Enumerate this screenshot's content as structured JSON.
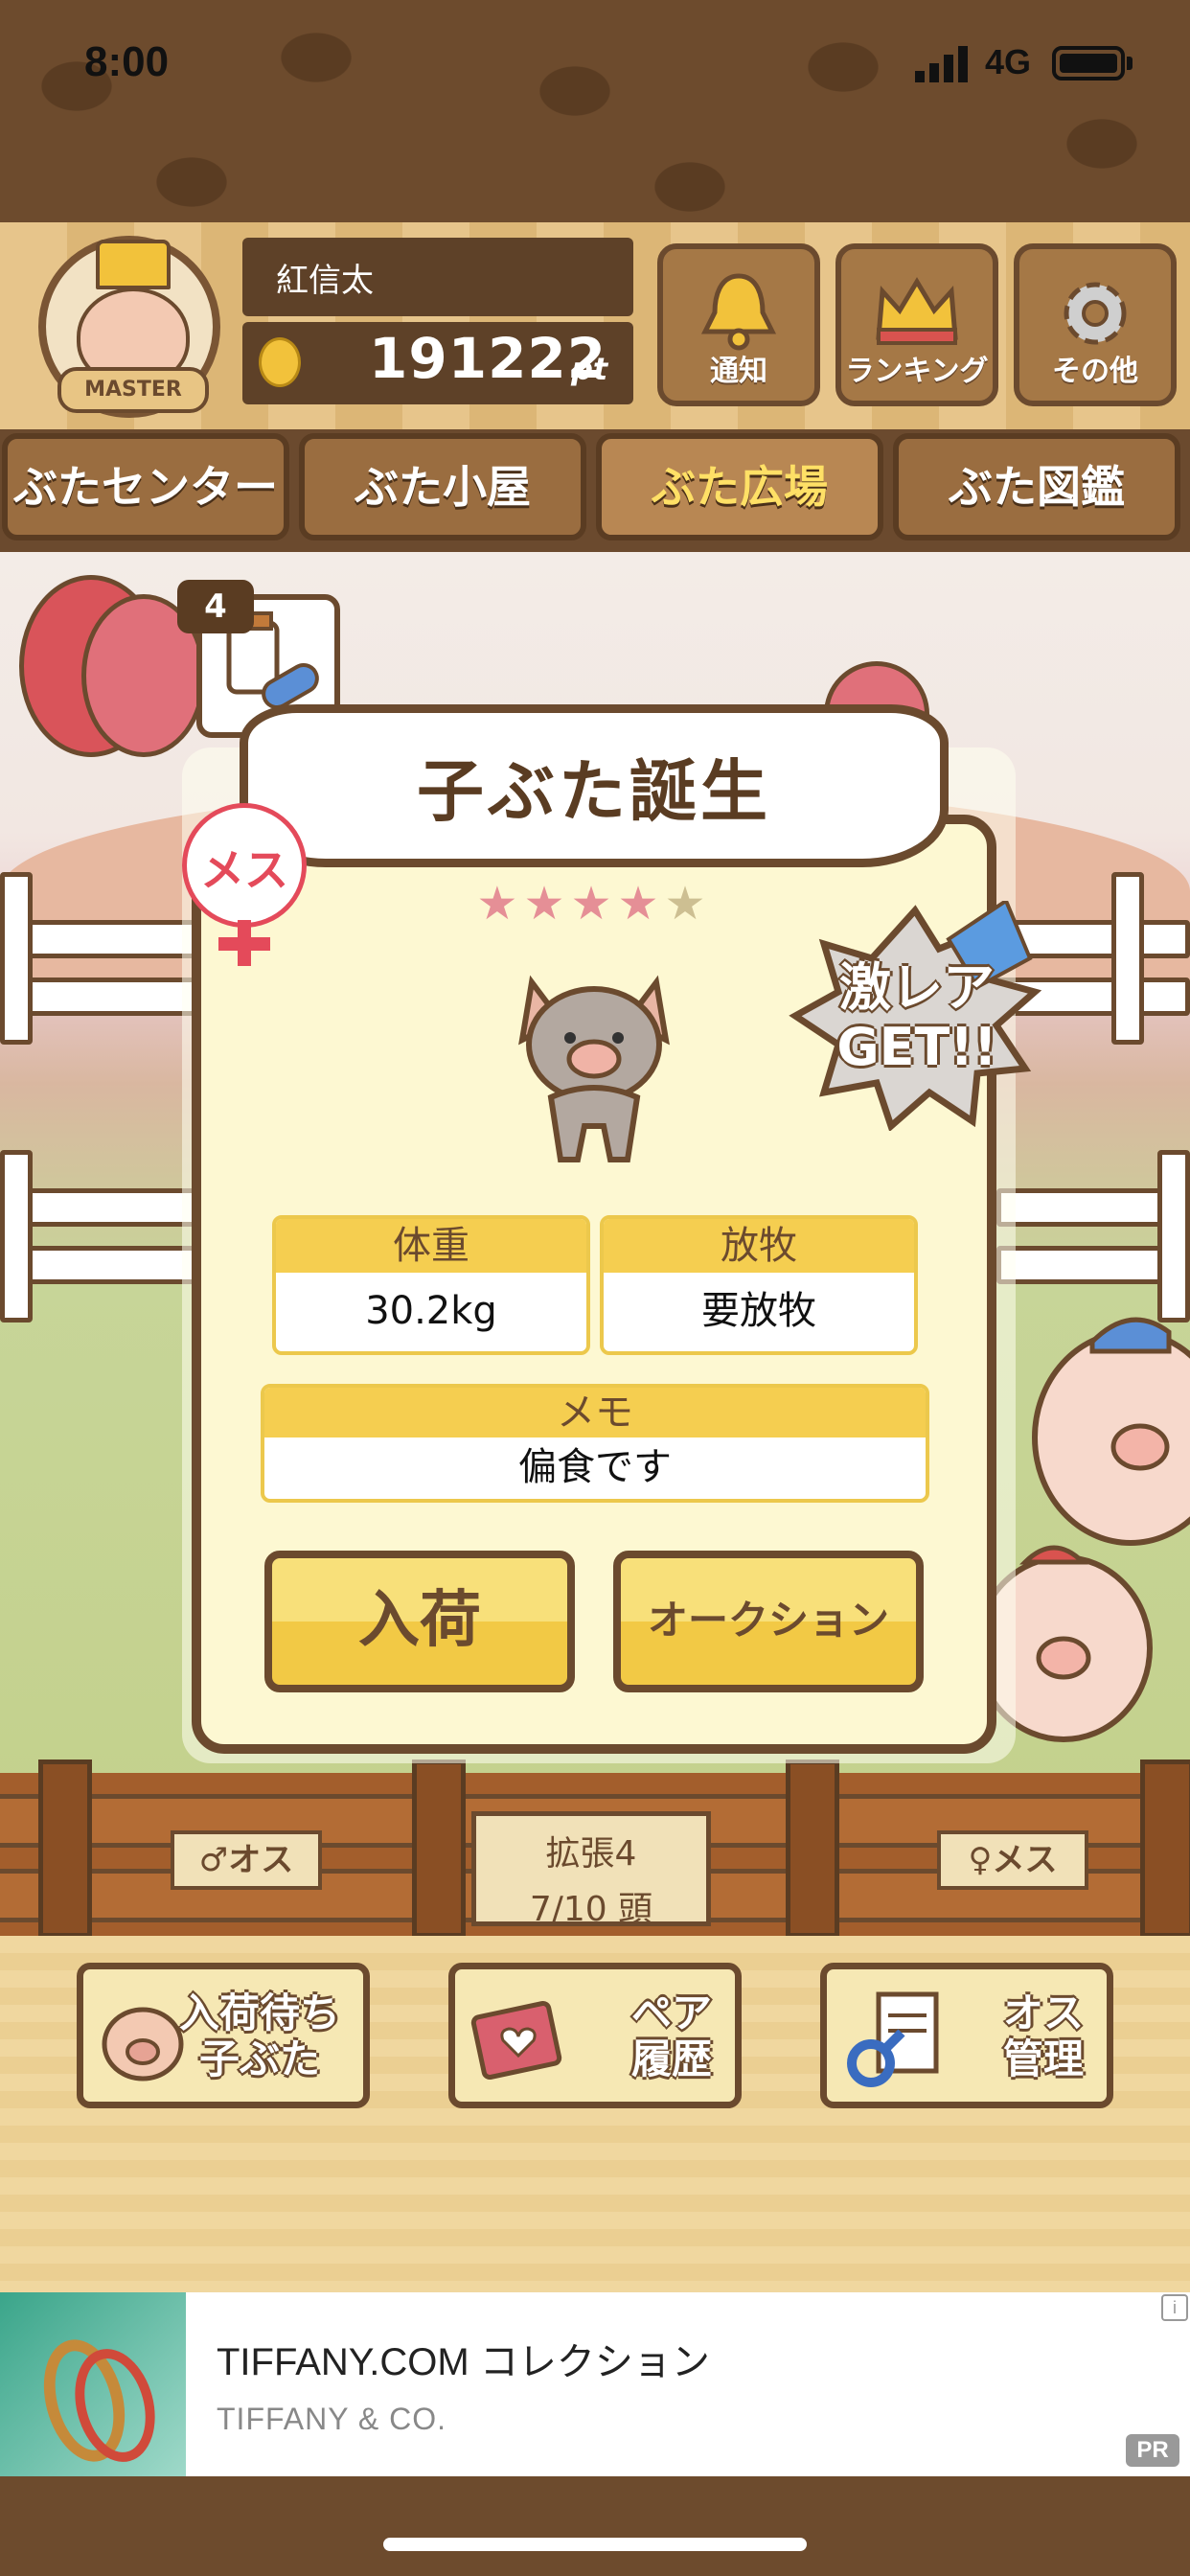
{
  "status_bar": {
    "time": "8:00",
    "network": "4G"
  },
  "header": {
    "username": "紅信太",
    "points": "191222",
    "points_unit": "pt",
    "rank_badge": "MASTER",
    "buttons": [
      {
        "label": "通知",
        "icon": "bell-icon"
      },
      {
        "label": "ランキング",
        "icon": "crown-icon"
      },
      {
        "label": "その他",
        "icon": "gear-icon"
      }
    ]
  },
  "nav_tabs": [
    {
      "label": "ぶたセンター",
      "active": false
    },
    {
      "label": "ぶた小屋",
      "active": false
    },
    {
      "label": "ぶた広場",
      "active": true
    },
    {
      "label": "ぶた図鑑",
      "active": false
    }
  ],
  "item": {
    "count": "4",
    "icon": "medicine-icon"
  },
  "modal": {
    "title": "子ぶた誕生",
    "gender": "メス",
    "rarity": {
      "filled": 4,
      "total": 5
    },
    "rare_badge": [
      "激レア",
      "GET!!"
    ],
    "weight": {
      "label": "体重",
      "value": "30.2kg"
    },
    "grazing": {
      "label": "放牧",
      "value": "要放牧"
    },
    "memo": {
      "label": "メモ",
      "value": "偏食です"
    },
    "buttons": {
      "stock": "入荷",
      "auction": "オークション"
    }
  },
  "fence": {
    "male_sign": "♂オス",
    "female_sign": "♀メス",
    "expand_title": "拡張4",
    "expand_count": "7/10 頭"
  },
  "actions": [
    {
      "label_line1": "入荷待ち",
      "label_line2": "子ぶた",
      "icon": "piglet-icon"
    },
    {
      "label_line1": "ペア",
      "label_line2": "履歴",
      "icon": "heart-book-icon"
    },
    {
      "label_line1": "オス",
      "label_line2": "管理",
      "icon": "male-document-icon"
    }
  ],
  "ad": {
    "title": "TIFFANY.COM コレクション",
    "advertiser": "TIFFANY & CO.",
    "badge": "PR",
    "info": "i"
  },
  "colors": {
    "wood_dark": "#6b4a2e",
    "accent_yellow": "#f5ce50",
    "female_red": "#e44a5a",
    "star_on": "#e58f96"
  }
}
